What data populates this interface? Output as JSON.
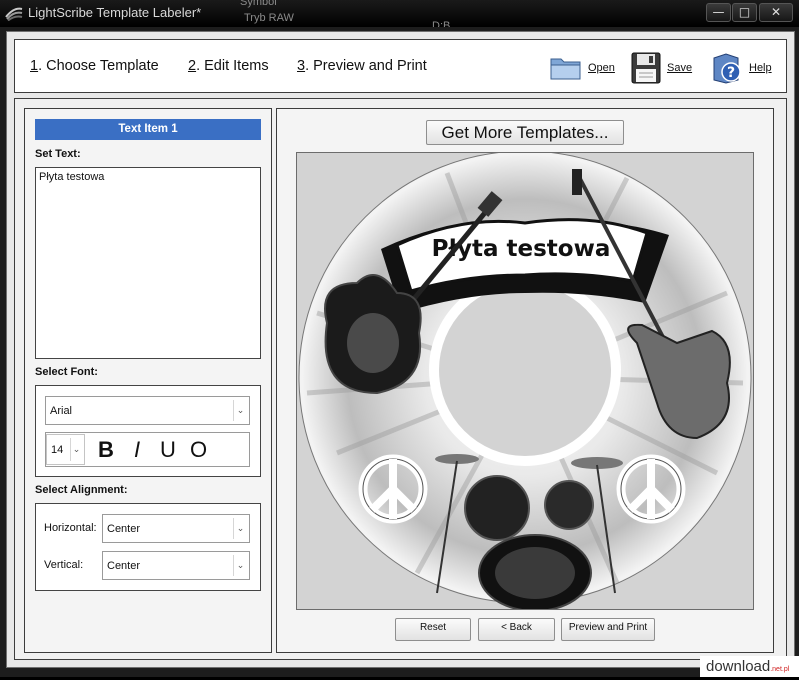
{
  "window": {
    "title": "LightScribe Template Labeler*",
    "background_text": [
      "Symbol",
      "Tryb RAW",
      "D:B"
    ]
  },
  "steps": [
    {
      "num": "1",
      "label": ". Choose Template"
    },
    {
      "num": "2",
      "label": ". Edit Items"
    },
    {
      "num": "3",
      "label": ". Preview and Print"
    }
  ],
  "toolbar": {
    "open": {
      "label": "Open",
      "icon": "folder-icon"
    },
    "save": {
      "label": "Save",
      "icon": "floppy-disk-icon"
    },
    "help": {
      "label": "Help",
      "icon": "help-book-icon"
    }
  },
  "edit": {
    "item_header": "Text Item 1",
    "set_text_label": "Set Text:",
    "text_value": "Płyta testowa",
    "select_font_label": "Select Font:",
    "font_name": "Arial",
    "font_size": "14",
    "format": {
      "bold": "B",
      "italic": "I",
      "underline": "U",
      "outline": "O"
    },
    "select_alignment_label": "Select Alignment:",
    "horizontal_label": "Horizontal:",
    "horizontal_value": "Center",
    "vertical_label": "Vertical:",
    "vertical_value": "Center"
  },
  "preview": {
    "get_more_button": "Get More Templates...",
    "disc_text": "Płyta testowa",
    "reset_button": "Reset",
    "back_button": "< Back",
    "preview_print_button": "Preview and Print"
  },
  "watermark": {
    "text": "download",
    "suffix": ".net.pl"
  },
  "colors": {
    "accent": "#3a6fc4",
    "titlebar": "#000000",
    "panel": "#f4f4f4"
  }
}
